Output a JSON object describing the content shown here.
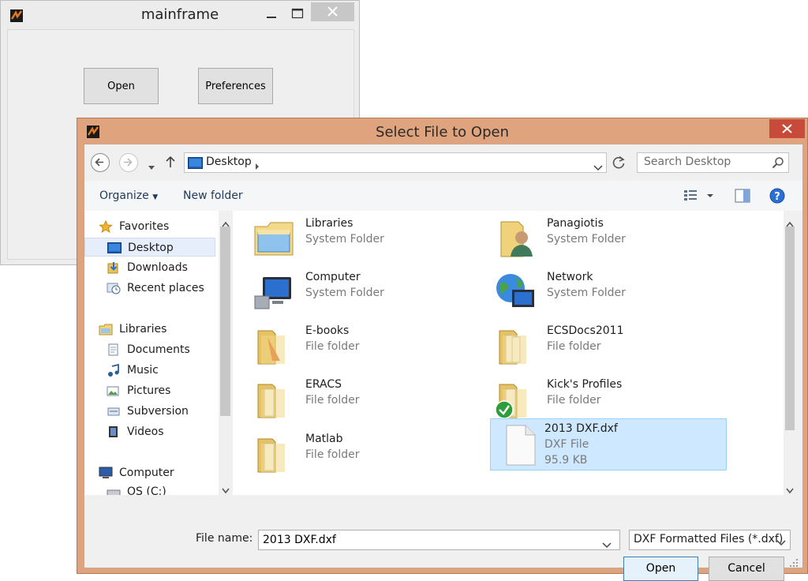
{
  "mainframe": {
    "title": "mainframe",
    "open_label": "Open",
    "preferences_label": "Preferences"
  },
  "dialog": {
    "title": "Select File to Open",
    "address": {
      "location": "Desktop"
    },
    "search": {
      "placeholder": "Search Desktop"
    },
    "toolbar": {
      "organize_label": "Organize",
      "new_folder_label": "New folder"
    },
    "nav": {
      "favorites": "Favorites",
      "desktop": "Desktop",
      "downloads": "Downloads",
      "recent": "Recent places",
      "libraries": "Libraries",
      "documents": "Documents",
      "music": "Music",
      "pictures": "Pictures",
      "subversion": "Subversion",
      "videos": "Videos",
      "computer": "Computer",
      "os_drive": "OS (C:)"
    },
    "files": [
      {
        "name": "Libraries",
        "type": "System Folder",
        "icon": "libraries-folder-icon"
      },
      {
        "name": "Panagiotis",
        "type": "System Folder",
        "icon": "user-folder-icon"
      },
      {
        "name": "Computer",
        "type": "System Folder",
        "icon": "computer-icon"
      },
      {
        "name": "Network",
        "type": "System Folder",
        "icon": "network-icon"
      },
      {
        "name": "E-books",
        "type": "File folder",
        "icon": "folder-icon"
      },
      {
        "name": "ECSDocs2011",
        "type": "File folder",
        "icon": "folder-icon"
      },
      {
        "name": "ERACS",
        "type": "File folder",
        "icon": "folder-icon"
      },
      {
        "name": "Kick's Profiles",
        "type": "File folder",
        "icon": "synced-folder-icon"
      },
      {
        "name": "Matlab",
        "type": "File folder",
        "icon": "folder-icon"
      },
      {
        "name": "2013 DXF.dxf",
        "type": "DXF File",
        "size": "95.9 KB",
        "icon": "file-icon"
      }
    ],
    "file_name_label": "File name:",
    "file_name_value": "2013 DXF.dxf",
    "file_type_value": "DXF Formatted Files (*.dxf)",
    "open_button": "Open",
    "cancel_button": "Cancel"
  },
  "colors": {
    "dialog_frame": "#dfa47e",
    "close_button": "#c74a3b",
    "selection": "#cde8ff",
    "accent_blue": "#1e64c8"
  }
}
